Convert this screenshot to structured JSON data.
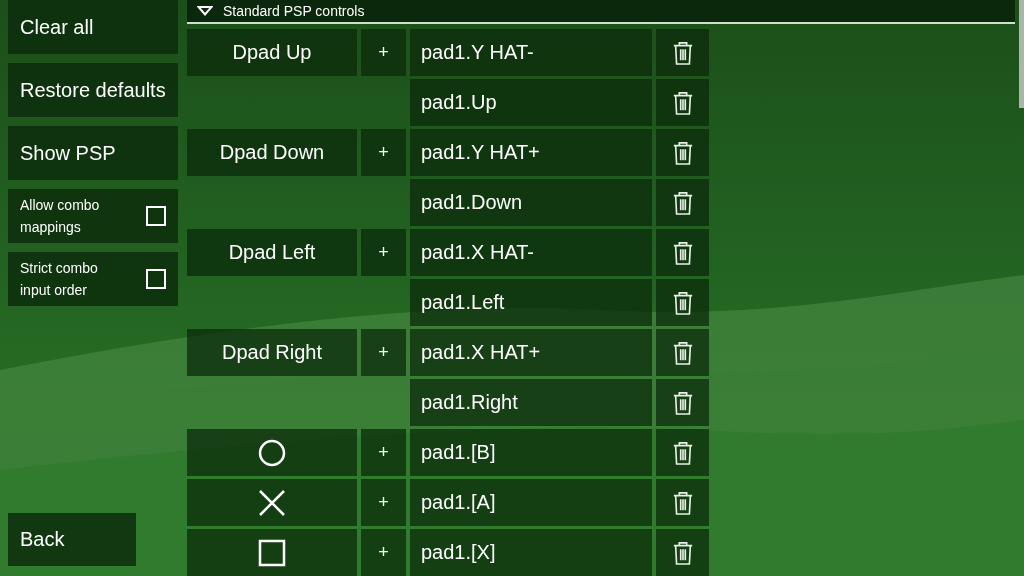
{
  "sidebar": {
    "buttons": [
      "Clear all",
      "Restore defaults",
      "Show PSP"
    ],
    "checkboxes": [
      {
        "label": "Allow combo mappings",
        "checked": false
      },
      {
        "label": "Strict combo input order",
        "checked": false
      }
    ],
    "back": "Back"
  },
  "section": {
    "title": "Standard PSP controls",
    "expanded": true
  },
  "controls": [
    {
      "kind": "label",
      "label": "Dpad Up",
      "add": "+",
      "mappings": [
        "pad1.Y HAT-",
        "pad1.Up"
      ]
    },
    {
      "kind": "label",
      "label": "Dpad Down",
      "add": "+",
      "mappings": [
        "pad1.Y HAT+",
        "pad1.Down"
      ]
    },
    {
      "kind": "label",
      "label": "Dpad Left",
      "add": "+",
      "mappings": [
        "pad1.X HAT-",
        "pad1.Left"
      ]
    },
    {
      "kind": "label",
      "label": "Dpad Right",
      "add": "+",
      "mappings": [
        "pad1.X HAT+",
        "pad1.Right"
      ]
    },
    {
      "kind": "circle",
      "add": "+",
      "mappings": [
        "pad1.[B]"
      ]
    },
    {
      "kind": "cross",
      "add": "+",
      "mappings": [
        "pad1.[A]"
      ]
    },
    {
      "kind": "square",
      "add": "+",
      "mappings": [
        "pad1.[X]"
      ]
    }
  ]
}
